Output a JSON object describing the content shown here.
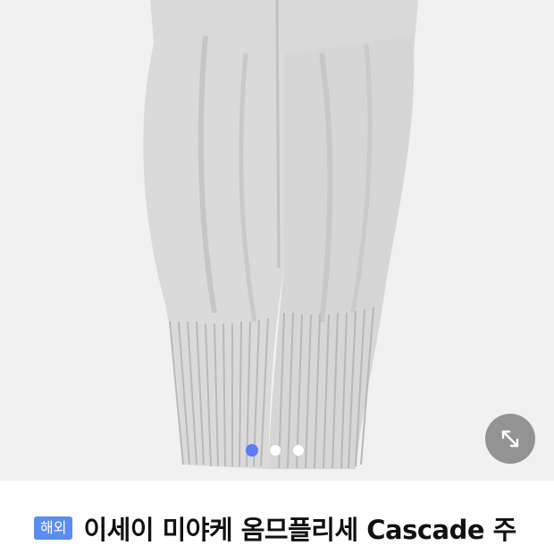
{
  "gallery": {
    "image_description_icon": "pleated-pants-photo",
    "pages": 3,
    "active_page": 1,
    "expand_icon": "expand-arrows-icon"
  },
  "product": {
    "badge": "해외",
    "title": "이세이 미야케 옴므플리세 Cascade 주"
  },
  "colors": {
    "accent": "#5b7cf6",
    "badge_bg": "#5b8cf0"
  }
}
